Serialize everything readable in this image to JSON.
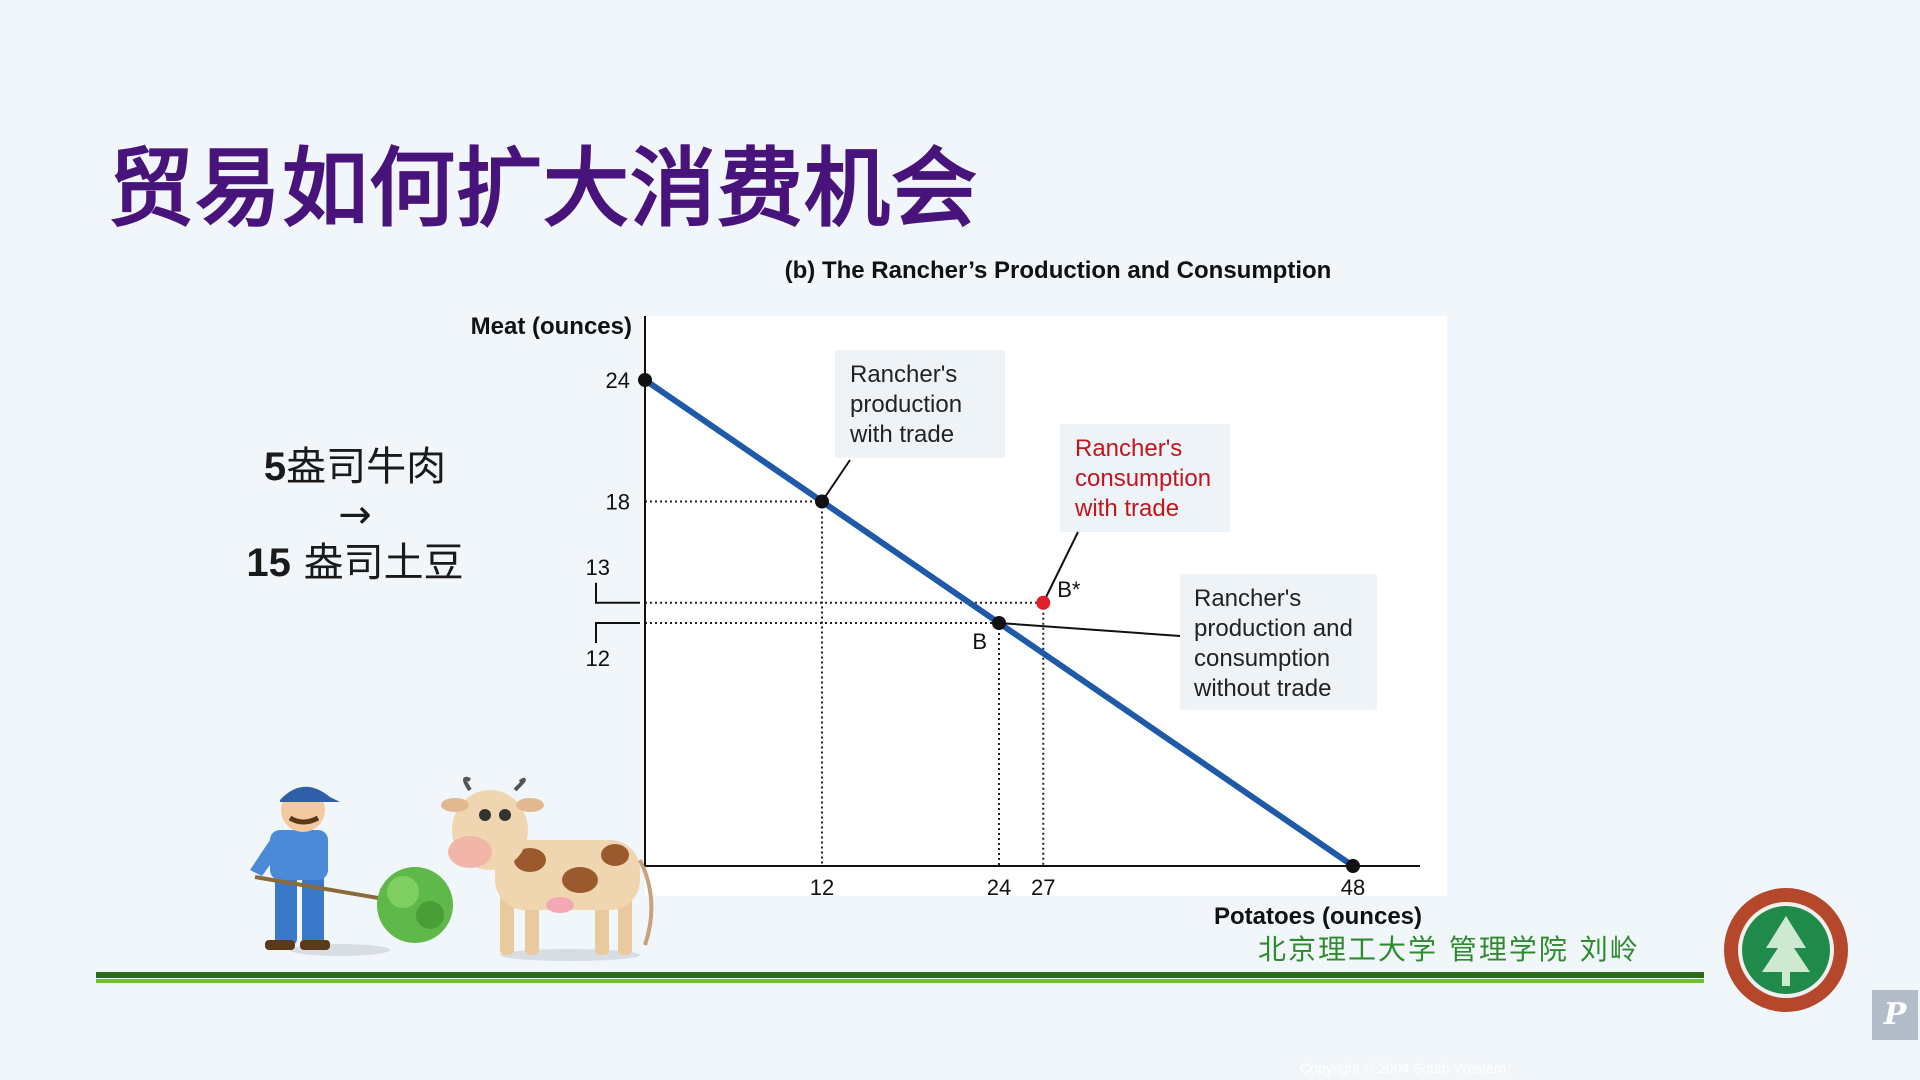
{
  "slide": {
    "title": "贸易如何扩大消费机会",
    "side_note": {
      "line1_num": "5",
      "line1_text": "盎司牛肉",
      "arrow": "→",
      "line2_num": "15",
      "line2_text": " 盎司土豆"
    },
    "footer_school": "北京理工大学 管理学院 刘岭",
    "copyright": "Copyright © 2004 South-Western",
    "app_icon": "P"
  },
  "chart_data": {
    "type": "line",
    "title": "(b) The Rancher’s Production and Consumption",
    "xlabel": "Potatoes (ounces)",
    "ylabel": "Meat (ounces)",
    "xlim": [
      0,
      48
    ],
    "ylim": [
      0,
      24
    ],
    "x_ticks": [
      12,
      24,
      27,
      48
    ],
    "x_tick_labels": [
      "12",
      "24",
      "27",
      "48"
    ],
    "y_ticks": [
      24,
      18,
      13,
      12
    ],
    "y_tick_labels": [
      "24",
      "18",
      "13",
      "12"
    ],
    "series": [
      {
        "color": "#1e5aa8",
        "points": [
          [
            0,
            24
          ],
          [
            48,
            0
          ]
        ]
      }
    ],
    "points": [
      {
        "x": 0,
        "y": 24,
        "label": "",
        "color": "#111111"
      },
      {
        "x": 12,
        "y": 18,
        "label": "",
        "color": "#111111"
      },
      {
        "x": 24,
        "y": 12,
        "label": "B",
        "color": "#111111"
      },
      {
        "x": 27,
        "y": 13,
        "label": "B*",
        "color": "#e0202a"
      },
      {
        "x": 48,
        "y": 0,
        "label": "",
        "color": "#111111"
      }
    ],
    "guides": [
      {
        "x": 12,
        "y": 18
      },
      {
        "x": 24,
        "y": 12
      },
      {
        "x": 27,
        "y": 13
      }
    ],
    "annotations": [
      {
        "lines": [
          "Rancher's",
          "production",
          "with trade"
        ],
        "color": "#222222",
        "target": [
          12,
          18
        ]
      },
      {
        "lines": [
          "Rancher's",
          "consumption",
          "with trade"
        ],
        "color": "#c0161c",
        "target": [
          27,
          13
        ]
      },
      {
        "lines": [
          "Rancher's",
          "production and",
          "consumption",
          "without trade"
        ],
        "color": "#222222",
        "target": [
          24,
          12
        ]
      }
    ],
    "grid": false,
    "legend": "none"
  }
}
